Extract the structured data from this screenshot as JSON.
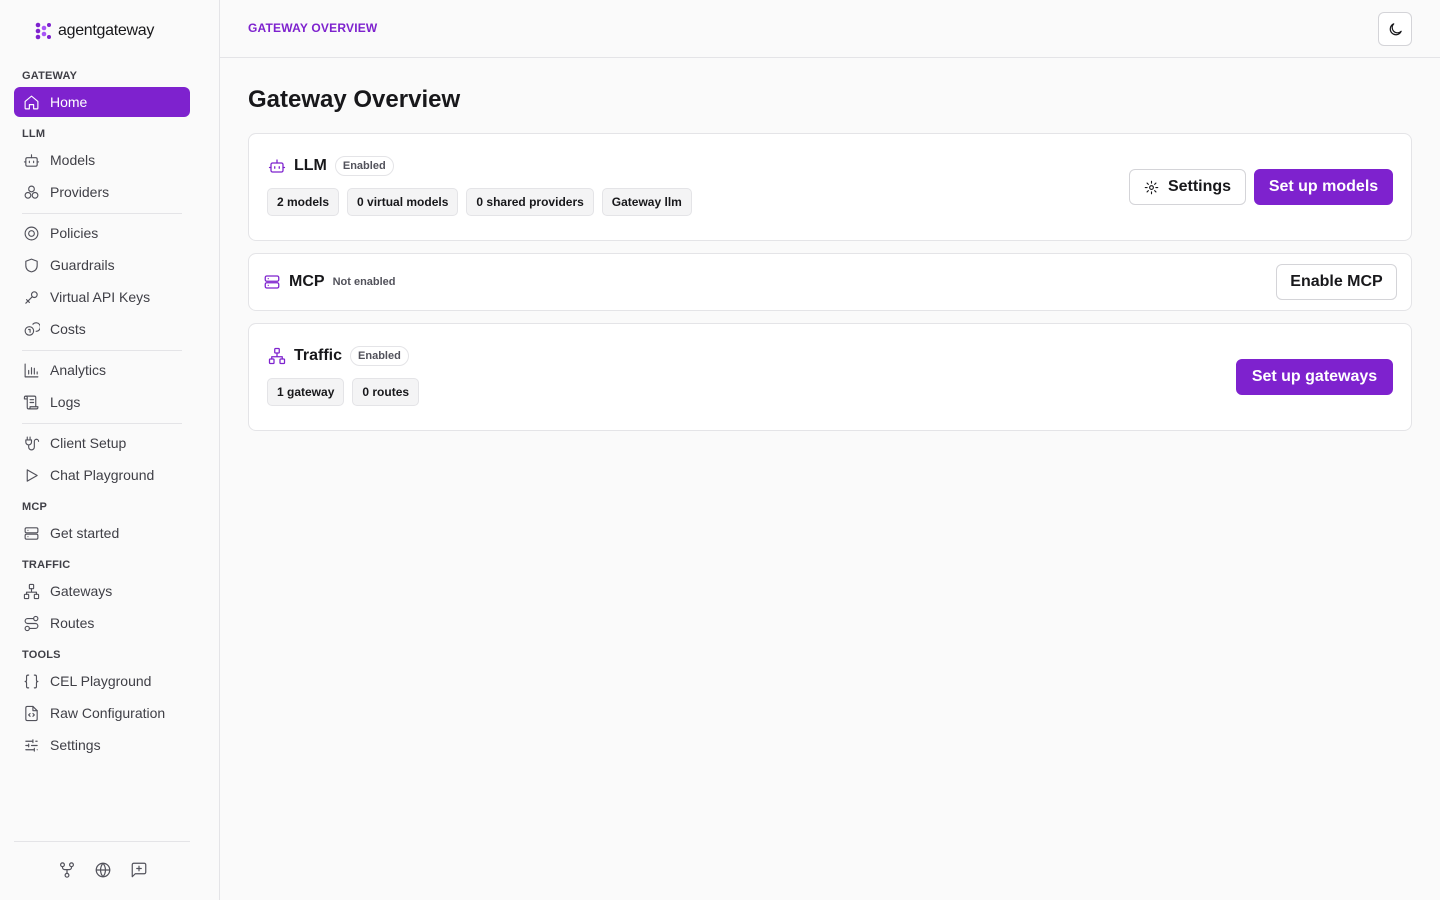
{
  "app": {
    "brand": "agentgateway",
    "accent": "#7e22ce"
  },
  "sidebar": {
    "sections": {
      "gateway": "GATEWAY",
      "llm": "LLM",
      "mcp": "MCP",
      "traffic": "TRAFFIC",
      "tools": "TOOLS"
    },
    "items": {
      "home": "Home",
      "models": "Models",
      "providers": "Providers",
      "policies": "Policies",
      "guardrails": "Guardrails",
      "virtual_api_keys": "Virtual API Keys",
      "costs": "Costs",
      "analytics": "Analytics",
      "logs": "Logs",
      "client_setup": "Client Setup",
      "chat_playground": "Chat Playground",
      "get_started": "Get started",
      "gateways": "Gateways",
      "routes": "Routes",
      "cel_playground": "CEL Playground",
      "raw_configuration": "Raw Configuration",
      "settings": "Settings"
    },
    "active": "home",
    "bottom_icons": [
      "git-fork-icon",
      "globe-icon",
      "feedback-icon"
    ]
  },
  "header": {
    "breadcrumb": "GATEWAY OVERVIEW",
    "theme_toggle_icon": "moon-icon"
  },
  "main": {
    "title": "Gateway Overview",
    "llm": {
      "title": "LLM",
      "status": "Enabled",
      "chips": [
        "2 models",
        "0 virtual models",
        "0 shared providers",
        "Gateway llm"
      ],
      "settings_label": "Settings",
      "primary_label": "Set up models"
    },
    "mcp": {
      "title": "MCP",
      "status": "Not enabled",
      "button_label": "Enable MCP"
    },
    "traffic": {
      "title": "Traffic",
      "status": "Enabled",
      "chips": [
        "1 gateway",
        "0 routes"
      ],
      "primary_label": "Set up gateways"
    }
  }
}
